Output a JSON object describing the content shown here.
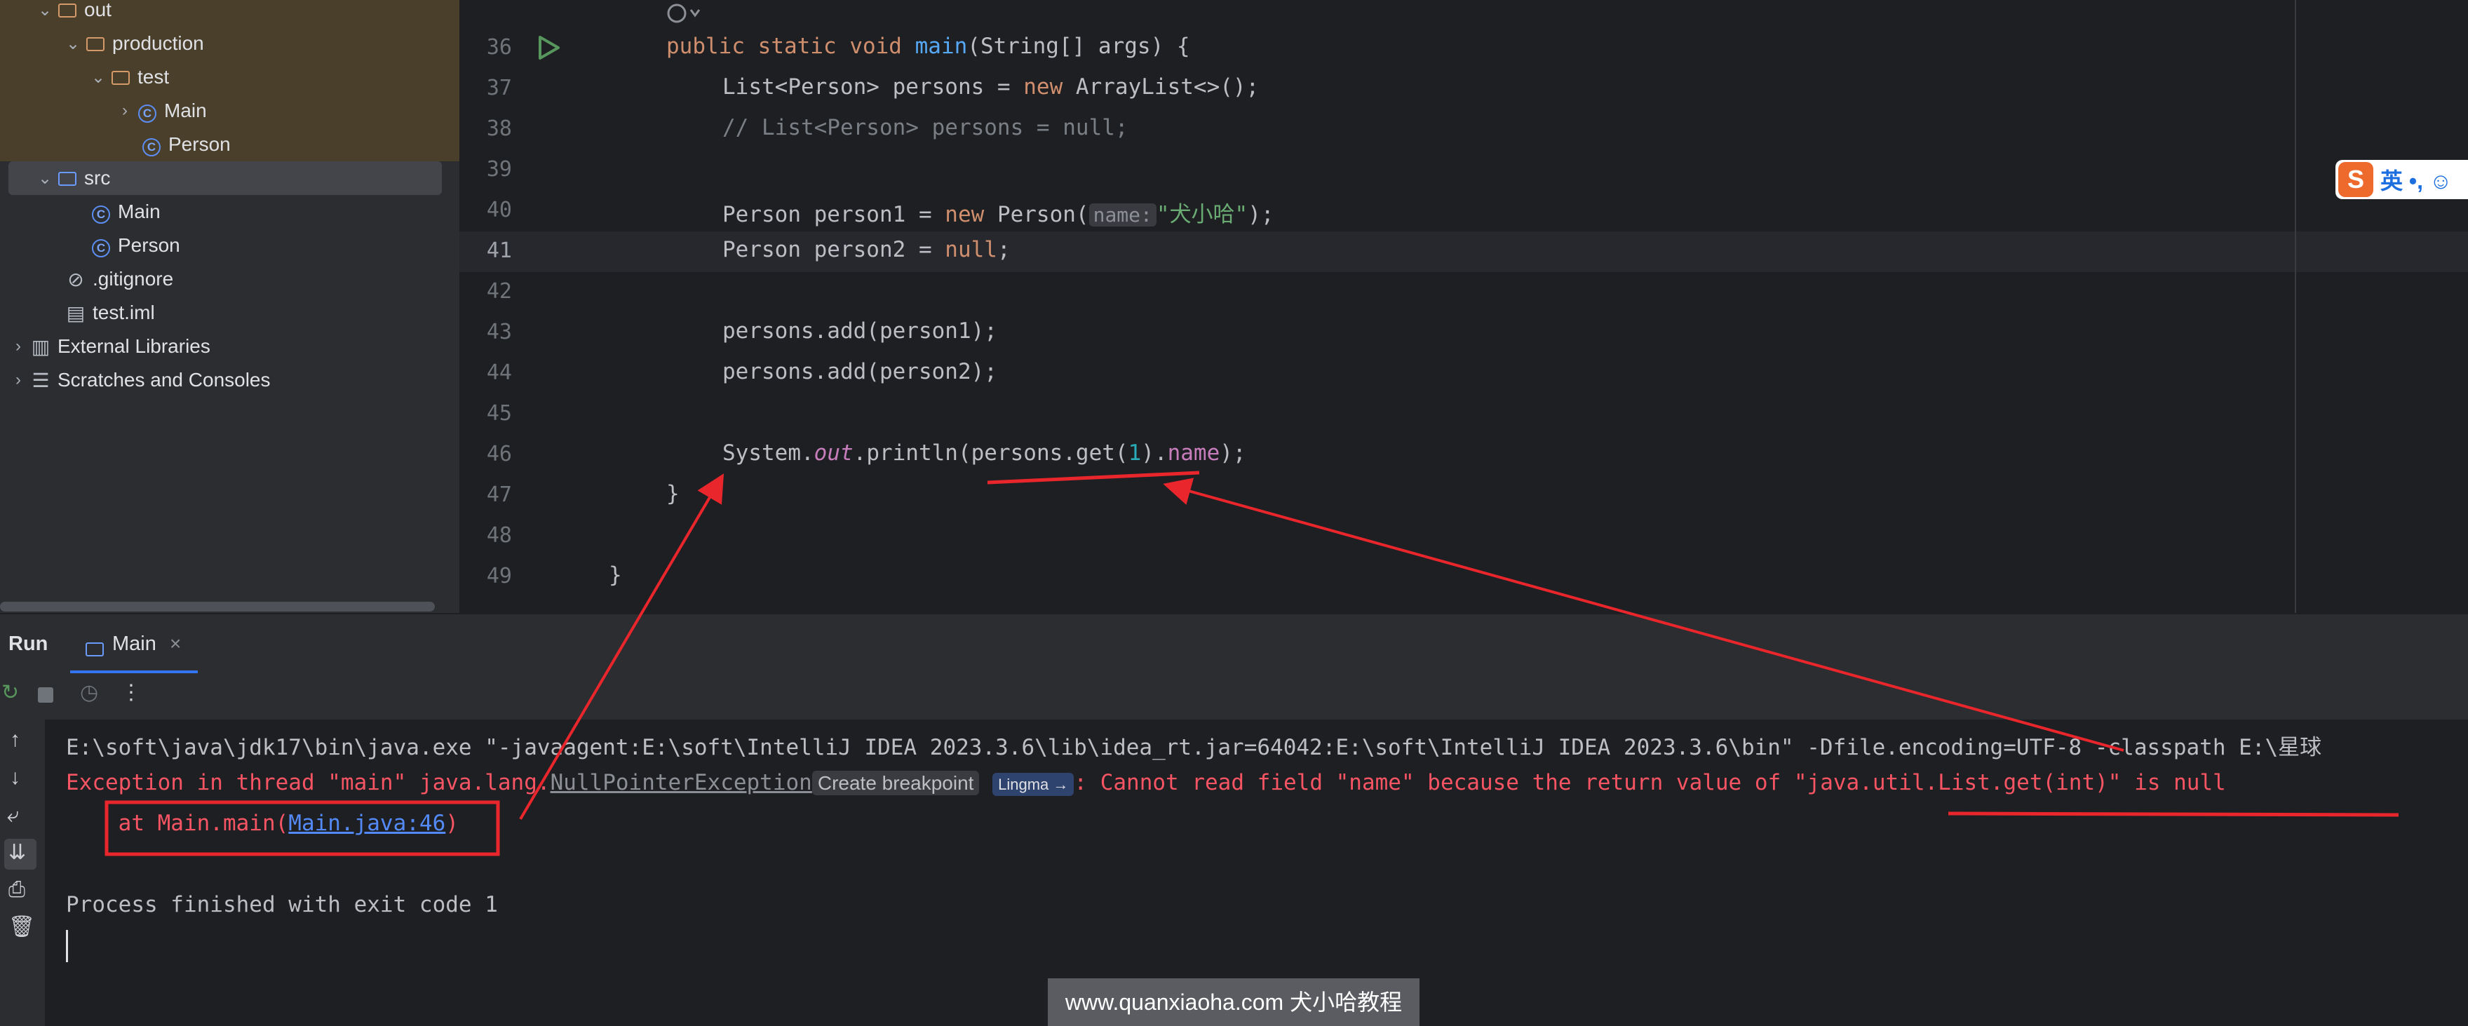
{
  "project_tree": {
    "items": [
      {
        "label": "out",
        "type": "folder-orange",
        "expanded": true
      },
      {
        "label": "production",
        "type": "folder-orange",
        "expanded": true
      },
      {
        "label": "test",
        "type": "folder-orange",
        "expanded": true
      },
      {
        "label": "Main",
        "type": "class-main",
        "expanded": false
      },
      {
        "label": "Person",
        "type": "class"
      },
      {
        "label": "src",
        "type": "folder-blue",
        "expanded": true
      },
      {
        "label": "Main",
        "type": "class-main"
      },
      {
        "label": "Person",
        "type": "class"
      },
      {
        "label": ".gitignore",
        "type": "ignore-file"
      },
      {
        "label": "test.iml",
        "type": "iml-file"
      },
      {
        "label": "External Libraries",
        "type": "library"
      },
      {
        "label": "Scratches and Consoles",
        "type": "scratches"
      }
    ]
  },
  "editor": {
    "lines": [
      {
        "num": "36",
        "code": "public static void main(String[] args) {"
      },
      {
        "num": "37",
        "code": "List<Person> persons = new ArrayList<>();"
      },
      {
        "num": "38",
        "code": "// List<Person> persons = null;"
      },
      {
        "num": "39",
        "code": ""
      },
      {
        "num": "40",
        "code": "Person person1 = new Person( name: \"犬小哈\");"
      },
      {
        "num": "41",
        "code": "Person person2 = null;"
      },
      {
        "num": "42",
        "code": ""
      },
      {
        "num": "43",
        "code": "persons.add(person1);"
      },
      {
        "num": "44",
        "code": "persons.add(person2);"
      },
      {
        "num": "45",
        "code": ""
      },
      {
        "num": "46",
        "code": "System.out.println(persons.get(1).name);"
      },
      {
        "num": "47",
        "code": "}"
      },
      {
        "num": "48",
        "code": ""
      },
      {
        "num": "49",
        "code": "}"
      }
    ],
    "param_hint": "name:",
    "string_literal": "\"犬小哈\""
  },
  "ime": {
    "logo": "S",
    "text": "英 •, ☺"
  },
  "run_panel": {
    "title": "Run",
    "tab_label": "Main",
    "console": {
      "cmd_line": "E:\\soft\\java\\jdk17\\bin\\java.exe \"-javaagent:E:\\soft\\IntelliJ IDEA 2023.3.6\\lib\\idea_rt.jar=64042:E:\\soft\\IntelliJ IDEA 2023.3.6\\bin\" -Dfile.encoding=UTF-8 -classpath E:\\星球",
      "exc_prefix": "Exception in thread \"main\" java.lang.",
      "exc_class": "NullPointerException",
      "create_breakpoint": "Create breakpoint",
      "lingma": "Lingma →",
      "exc_message": ": Cannot read field \"name\" because the return value of \"java.util.List.get(int)\" is null",
      "at_prefix": "    at Main.main(",
      "at_link": "Main.java:46",
      "at_suffix": ")",
      "finished": "Process finished with exit code 1"
    }
  },
  "watermark": "www.quanxiaoha.com 犬小哈教程",
  "colors": {
    "annotation_red": "#e8262c",
    "accent": "#3574f0"
  }
}
